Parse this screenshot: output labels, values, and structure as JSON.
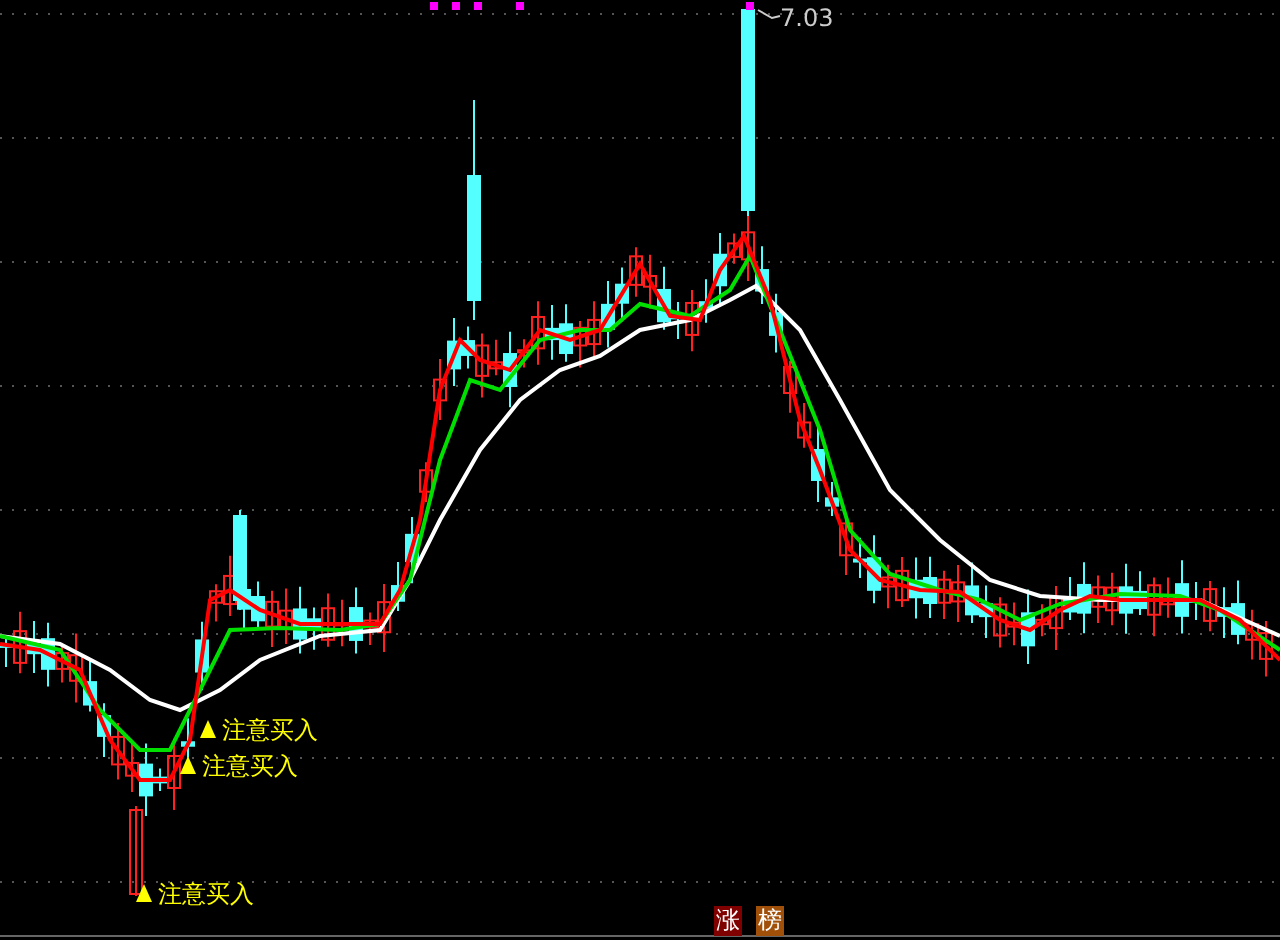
{
  "chart": {
    "high_label": "7.03",
    "signals": [
      {
        "text": "注意买入"
      },
      {
        "text": "注意买入"
      },
      {
        "text": "注意买入"
      }
    ]
  },
  "tags": [
    {
      "text": "涨",
      "color": "#800000"
    },
    {
      "text": "榜",
      "color": "#a05008"
    }
  ]
}
